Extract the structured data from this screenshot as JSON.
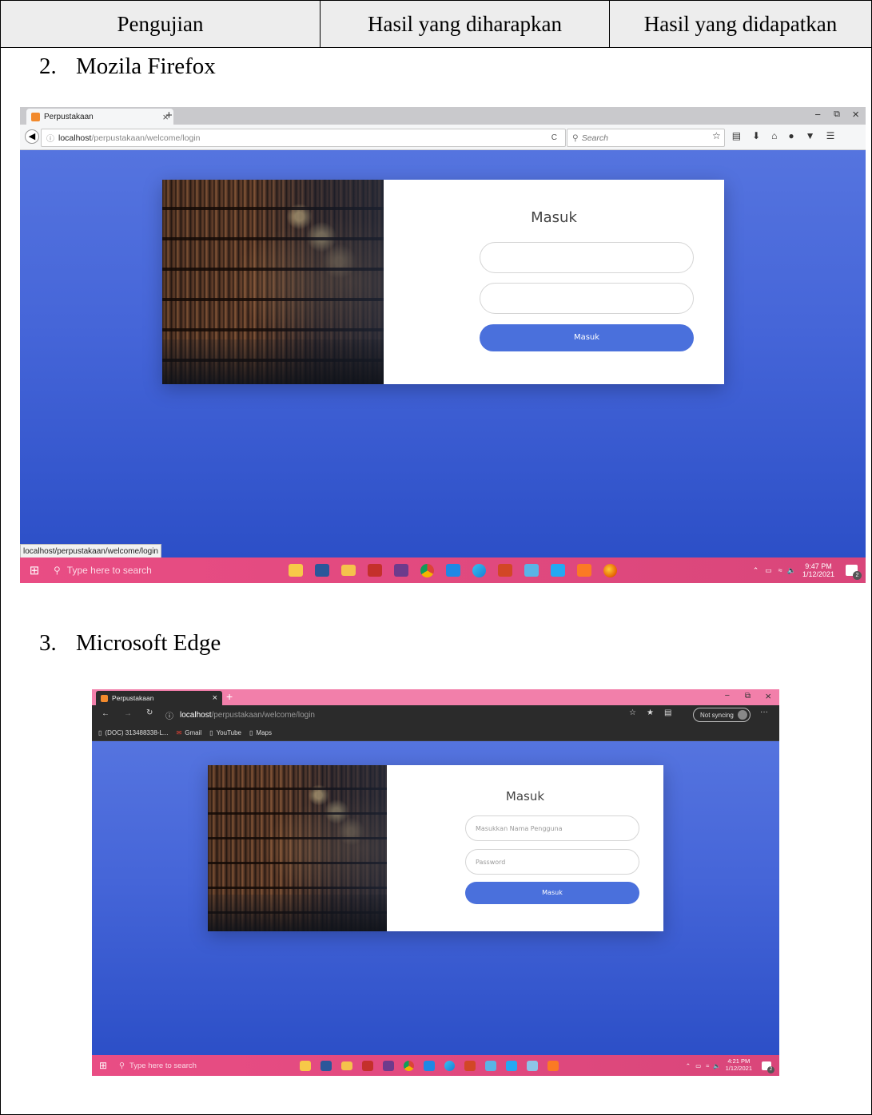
{
  "table_header": {
    "col1": "Pengujian",
    "col2": "Hasil yang diharapkan",
    "col3": "Hasil yang didapatkan"
  },
  "sections": [
    {
      "number": "2.",
      "title": "Mozila Firefox"
    },
    {
      "number": "3.",
      "title": "Microsoft Edge"
    }
  ],
  "firefox": {
    "tab_title": "Perpustakaan",
    "tab_close": "×",
    "new_tab": "+",
    "window_controls": {
      "minimize": "−",
      "restore": "⧉",
      "close": "×"
    },
    "url_host": "localhost",
    "url_path": "/perpustakaan/welcome/login",
    "reload": "C",
    "search_placeholder": "Search",
    "status_url": "localhost/perpustakaan/welcome/login",
    "login": {
      "title": "Masuk",
      "username_placeholder": "",
      "password_placeholder": "",
      "button_label": "Masuk"
    },
    "taskbar": {
      "search_placeholder": "Type here to search",
      "time": "9:47 PM",
      "date": "1/12/2021",
      "notification_count": "2"
    }
  },
  "edge": {
    "tab_title": "Perpustakaan",
    "tab_close": "×",
    "new_tab": "+",
    "window_controls": {
      "minimize": "−",
      "restore": "⧉",
      "close": "×"
    },
    "url_host": "localhost",
    "url_path": "/perpustakaan/welcome/login",
    "sync_label": "Not syncing",
    "more": "···",
    "bookmarks": [
      "(DOC) 313488338-L...",
      "Gmail",
      "YouTube",
      "Maps"
    ],
    "login": {
      "title": "Masuk",
      "username_placeholder": "Masukkan Nama Pengguna",
      "password_placeholder": "Password",
      "button_label": "Masuk"
    },
    "taskbar": {
      "search_placeholder": "Type here to search",
      "time": "4:21 PM",
      "date": "1/12/2021",
      "notification_count": "2"
    }
  },
  "colors": {
    "page_gradient_top": "#5574df",
    "page_gradient_bottom": "#2c4fc7",
    "button": "#4a70dc",
    "taskbar": "#e94d84",
    "edge_tabbar": "#f27faa",
    "edge_chrome": "#2b2b2b"
  },
  "icons": {
    "firefox_taskbar": [
      "store-icon",
      "word-icon",
      "file-explorer-icon",
      "tube-app-icon",
      "spss-icon",
      "chrome-icon",
      "media-icon",
      "edge-icon",
      "powerpoint-icon",
      "app-icon",
      "vscode-icon",
      "xampp-icon",
      "firefox-icon"
    ],
    "edge_taskbar": [
      "store-icon",
      "word-icon",
      "file-explorer-icon",
      "tube-app-icon",
      "spss-icon",
      "chrome-icon",
      "media-icon",
      "edge-icon",
      "powerpoint-icon",
      "app-icon",
      "vscode-icon",
      "paint-icon",
      "xampp-icon"
    ]
  }
}
